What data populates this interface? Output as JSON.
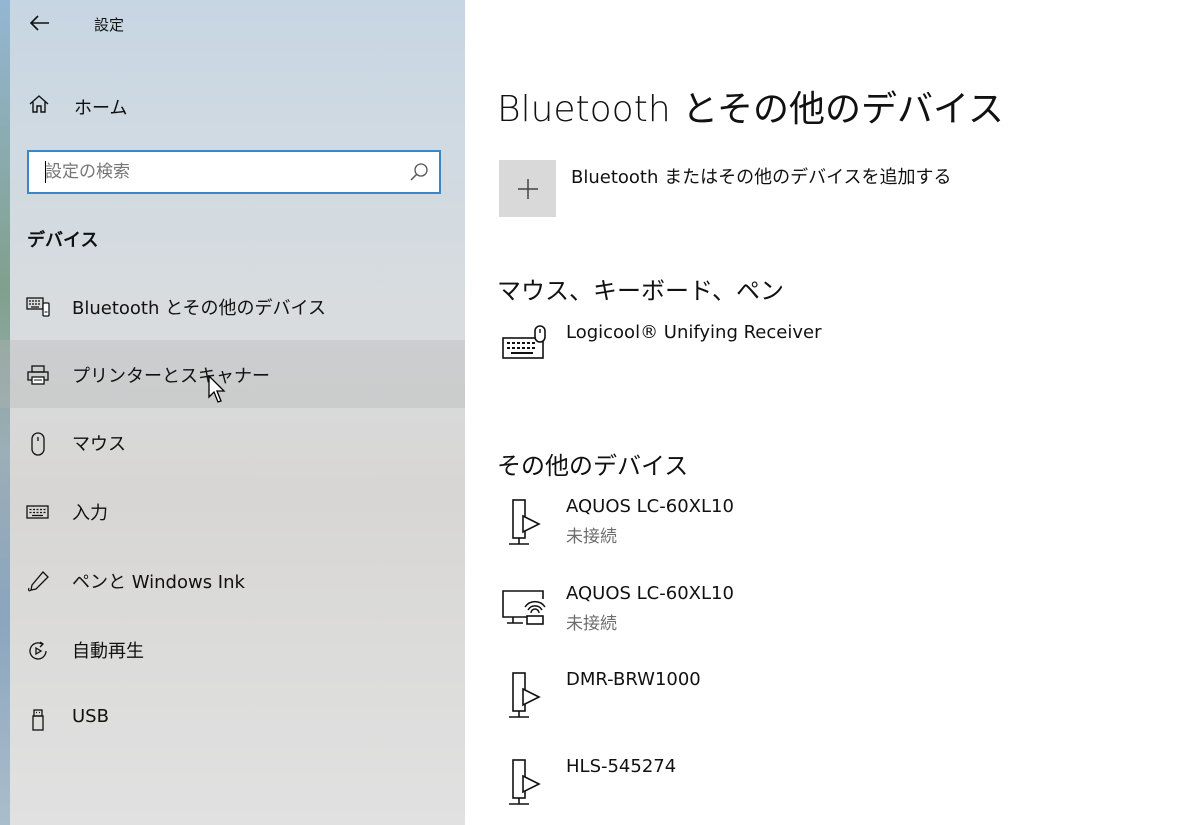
{
  "window": {
    "title": "設定"
  },
  "sidebar": {
    "home_label": "ホーム",
    "search": {
      "placeholder": "設定の検索",
      "value": ""
    },
    "section_heading": "デバイス",
    "items": [
      {
        "label": "Bluetooth とその他のデバイス",
        "icon": "bluetooth-devices-icon"
      },
      {
        "label": "プリンターとスキャナー",
        "icon": "printer-icon"
      },
      {
        "label": "マウス",
        "icon": "mouse-icon"
      },
      {
        "label": "入力",
        "icon": "keyboard-icon"
      },
      {
        "label": "ペンと Windows Ink",
        "icon": "pen-icon"
      },
      {
        "label": "自動再生",
        "icon": "autoplay-icon"
      },
      {
        "label": "USB",
        "icon": "usb-icon"
      }
    ],
    "hovered_item": "プリンターとスキャナー"
  },
  "main": {
    "title": "Bluetooth とその他のデバイス",
    "add_device_label": "Bluetooth またはその他のデバイスを追加する",
    "groups": [
      {
        "title": "マウス、キーボード、ペン",
        "devices": [
          {
            "name": "Logicool® Unifying Receiver",
            "status": "",
            "icon": "keyboard-mouse-icon"
          }
        ]
      },
      {
        "title": "その他のデバイス",
        "devices": [
          {
            "name": "AQUOS LC-60XL10",
            "status": "未接続",
            "icon": "media-device-icon"
          },
          {
            "name": "AQUOS LC-60XL10",
            "status": "未接続",
            "icon": "wireless-display-icon"
          },
          {
            "name": "DMR-BRW1000",
            "status": "",
            "icon": "media-device-icon"
          },
          {
            "name": "HLS-545274",
            "status": "",
            "icon": "media-device-icon"
          }
        ]
      }
    ]
  },
  "colors": {
    "search_border": "#3b85c9",
    "add_button_bg": "#d9d9d9",
    "status_text": "#6d6d6d"
  }
}
